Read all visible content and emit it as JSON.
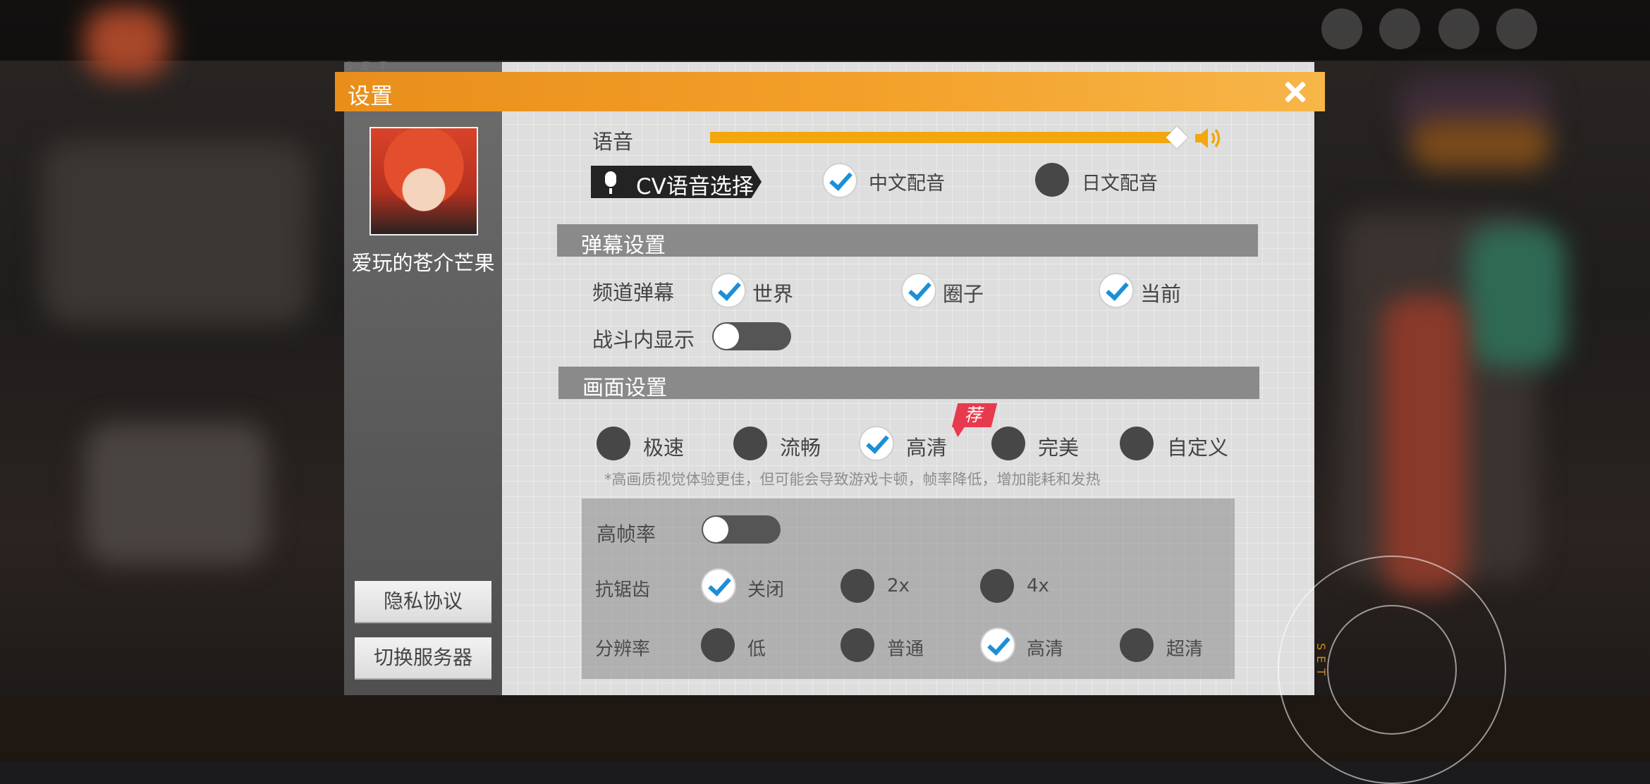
{
  "dialog": {
    "title": "设置",
    "set_mark": "SET",
    "close_icon": "close-icon"
  },
  "sidebar": {
    "player_name": "爱玩的苍介芒果",
    "privacy_button": "隐私协议",
    "switch_server_button": "切换服务器"
  },
  "voice": {
    "label": "语音",
    "volume_level": 1.0,
    "cv_select_label": "CV语音选择",
    "options": [
      {
        "label": "中文配音",
        "selected": true
      },
      {
        "label": "日文配音",
        "selected": false
      }
    ]
  },
  "barrage": {
    "section_title": "弹幕设置",
    "channel_label": "频道弹幕",
    "channels": [
      {
        "label": "世界",
        "checked": true
      },
      {
        "label": "圈子",
        "checked": true
      },
      {
        "label": "当前",
        "checked": true
      }
    ],
    "in_battle_label": "战斗内显示",
    "in_battle_on": false
  },
  "graphics": {
    "section_title": "画面设置",
    "presets": [
      {
        "label": "极速",
        "selected": false
      },
      {
        "label": "流畅",
        "selected": false
      },
      {
        "label": "高清",
        "selected": true
      },
      {
        "label": "完美",
        "selected": false
      },
      {
        "label": "自定义",
        "selected": false
      }
    ],
    "recommended_badge": "荐",
    "note": "*高画质视觉体验更佳，但可能会导致游戏卡顿，帧率降低，增加能耗和发热",
    "high_fps_label": "高帧率",
    "high_fps_on": false,
    "antialias_label": "抗锯齿",
    "antialias_options": [
      {
        "label": "关闭",
        "selected": true
      },
      {
        "label": "2x",
        "selected": false
      },
      {
        "label": "4x",
        "selected": false
      }
    ],
    "resolution_label": "分辨率",
    "resolution_options": [
      {
        "label": "低",
        "selected": false
      },
      {
        "label": "普通",
        "selected": false
      },
      {
        "label": "高清",
        "selected": true
      },
      {
        "label": "超清",
        "selected": false
      }
    ]
  },
  "colors": {
    "accent": "#f2a70d",
    "title_bar": "#ee9822",
    "check_blue": "#1c8fd6",
    "badge_red": "#e83a4e"
  }
}
